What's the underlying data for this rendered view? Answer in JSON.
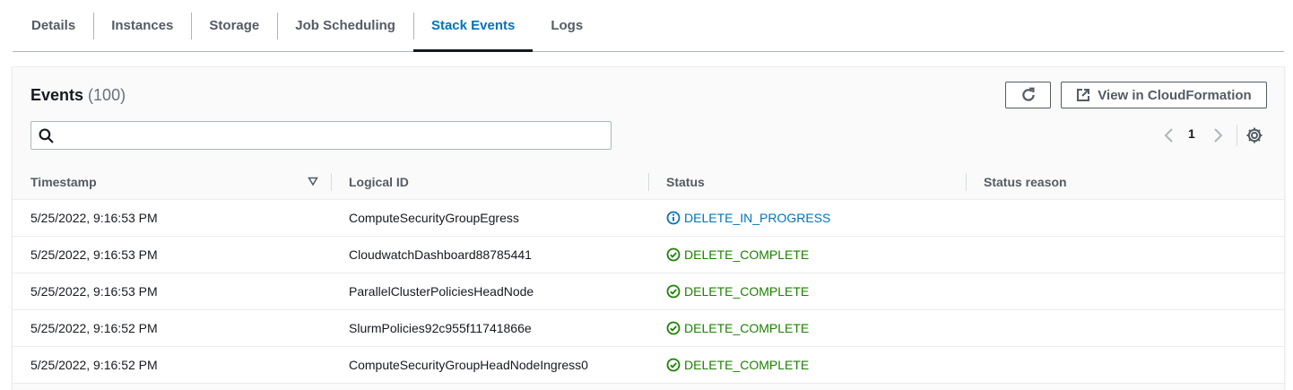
{
  "tabs": [
    {
      "label": "Details",
      "active": false
    },
    {
      "label": "Instances",
      "active": false
    },
    {
      "label": "Storage",
      "active": false
    },
    {
      "label": "Job Scheduling",
      "active": false
    },
    {
      "label": "Stack Events",
      "active": true
    },
    {
      "label": "Logs",
      "active": false
    }
  ],
  "events": {
    "title": "Events",
    "count": "(100)",
    "view_button_label": "View in CloudFormation",
    "search": {
      "value": "",
      "placeholder": ""
    },
    "pagination": {
      "current_page": "1"
    },
    "columns": [
      "Timestamp",
      "Logical ID",
      "Status",
      "Status reason"
    ],
    "rows": [
      {
        "timestamp": "5/25/2022, 9:16:53 PM",
        "logical_id": "ComputeSecurityGroupEgress",
        "status": "DELETE_IN_PROGRESS",
        "status_type": "in-progress",
        "reason": ""
      },
      {
        "timestamp": "5/25/2022, 9:16:53 PM",
        "logical_id": "CloudwatchDashboard88785441",
        "status": "DELETE_COMPLETE",
        "status_type": "complete",
        "reason": ""
      },
      {
        "timestamp": "5/25/2022, 9:16:53 PM",
        "logical_id": "ParallelClusterPoliciesHeadNode",
        "status": "DELETE_COMPLETE",
        "status_type": "complete",
        "reason": ""
      },
      {
        "timestamp": "5/25/2022, 9:16:52 PM",
        "logical_id": "SlurmPolicies92c955f11741866e",
        "status": "DELETE_COMPLETE",
        "status_type": "complete",
        "reason": ""
      },
      {
        "timestamp": "5/25/2022, 9:16:52 PM",
        "logical_id": "ComputeSecurityGroupHeadNodeIngress0",
        "status": "DELETE_COMPLETE",
        "status_type": "complete",
        "reason": ""
      }
    ]
  },
  "colors": {
    "accent": "#0073bb",
    "success": "#1d8102",
    "text": "#16191f",
    "muted": "#545b64"
  },
  "icons": {
    "refresh": "refresh-icon",
    "external": "external-link-icon",
    "search": "search-icon",
    "prev": "chevron-left-icon",
    "next": "chevron-right-icon",
    "settings": "gear-icon",
    "sort": "sort-down-icon",
    "in_progress": "info-circle-icon",
    "complete": "check-circle-icon"
  }
}
